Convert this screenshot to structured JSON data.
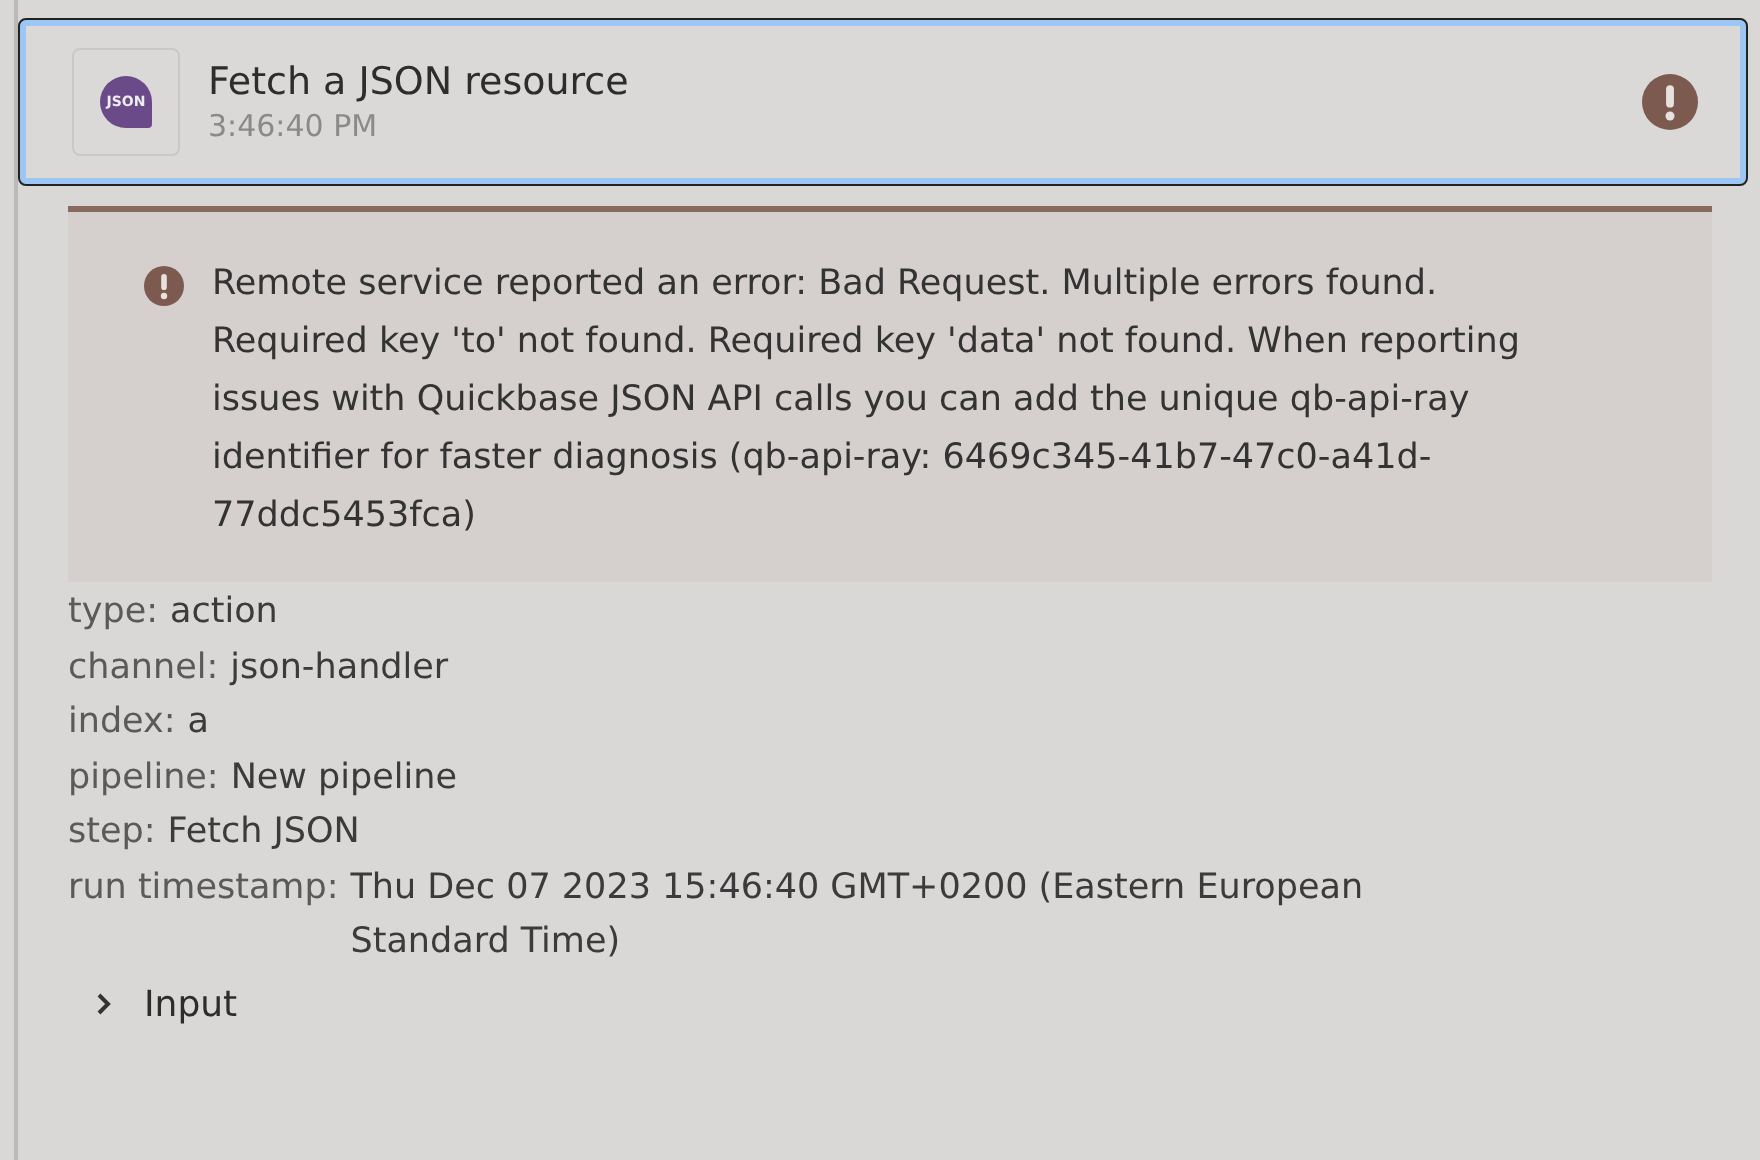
{
  "event": {
    "logo_text": "JSON",
    "title": "Fetch a JSON resource",
    "time": "3:46:40 PM",
    "has_error": true,
    "selected": true
  },
  "error": {
    "message": "Remote service reported an error: Bad Request. Multiple errors found. Required key 'to' not found. Required key 'data' not found. When reporting issues with Quickbase JSON API calls you can add the unique qb-api-ray identifier for faster diagnosis (qb-api-ray: 6469c345-41b7-47c0-a41d-77ddc5453fca)"
  },
  "details": [
    {
      "label": "type:",
      "value": "action"
    },
    {
      "label": "channel:",
      "value": "json-handler"
    },
    {
      "label": "index:",
      "value": "a"
    },
    {
      "label": "pipeline:",
      "value": "New pipeline"
    },
    {
      "label": "step:",
      "value": "Fetch JSON"
    },
    {
      "label": "run timestamp:",
      "value": "Thu Dec 07 2023 15:46:40 GMT+0200 (Eastern European Standard Time)"
    }
  ],
  "sections": [
    {
      "label": "Input",
      "expanded": false
    }
  ]
}
